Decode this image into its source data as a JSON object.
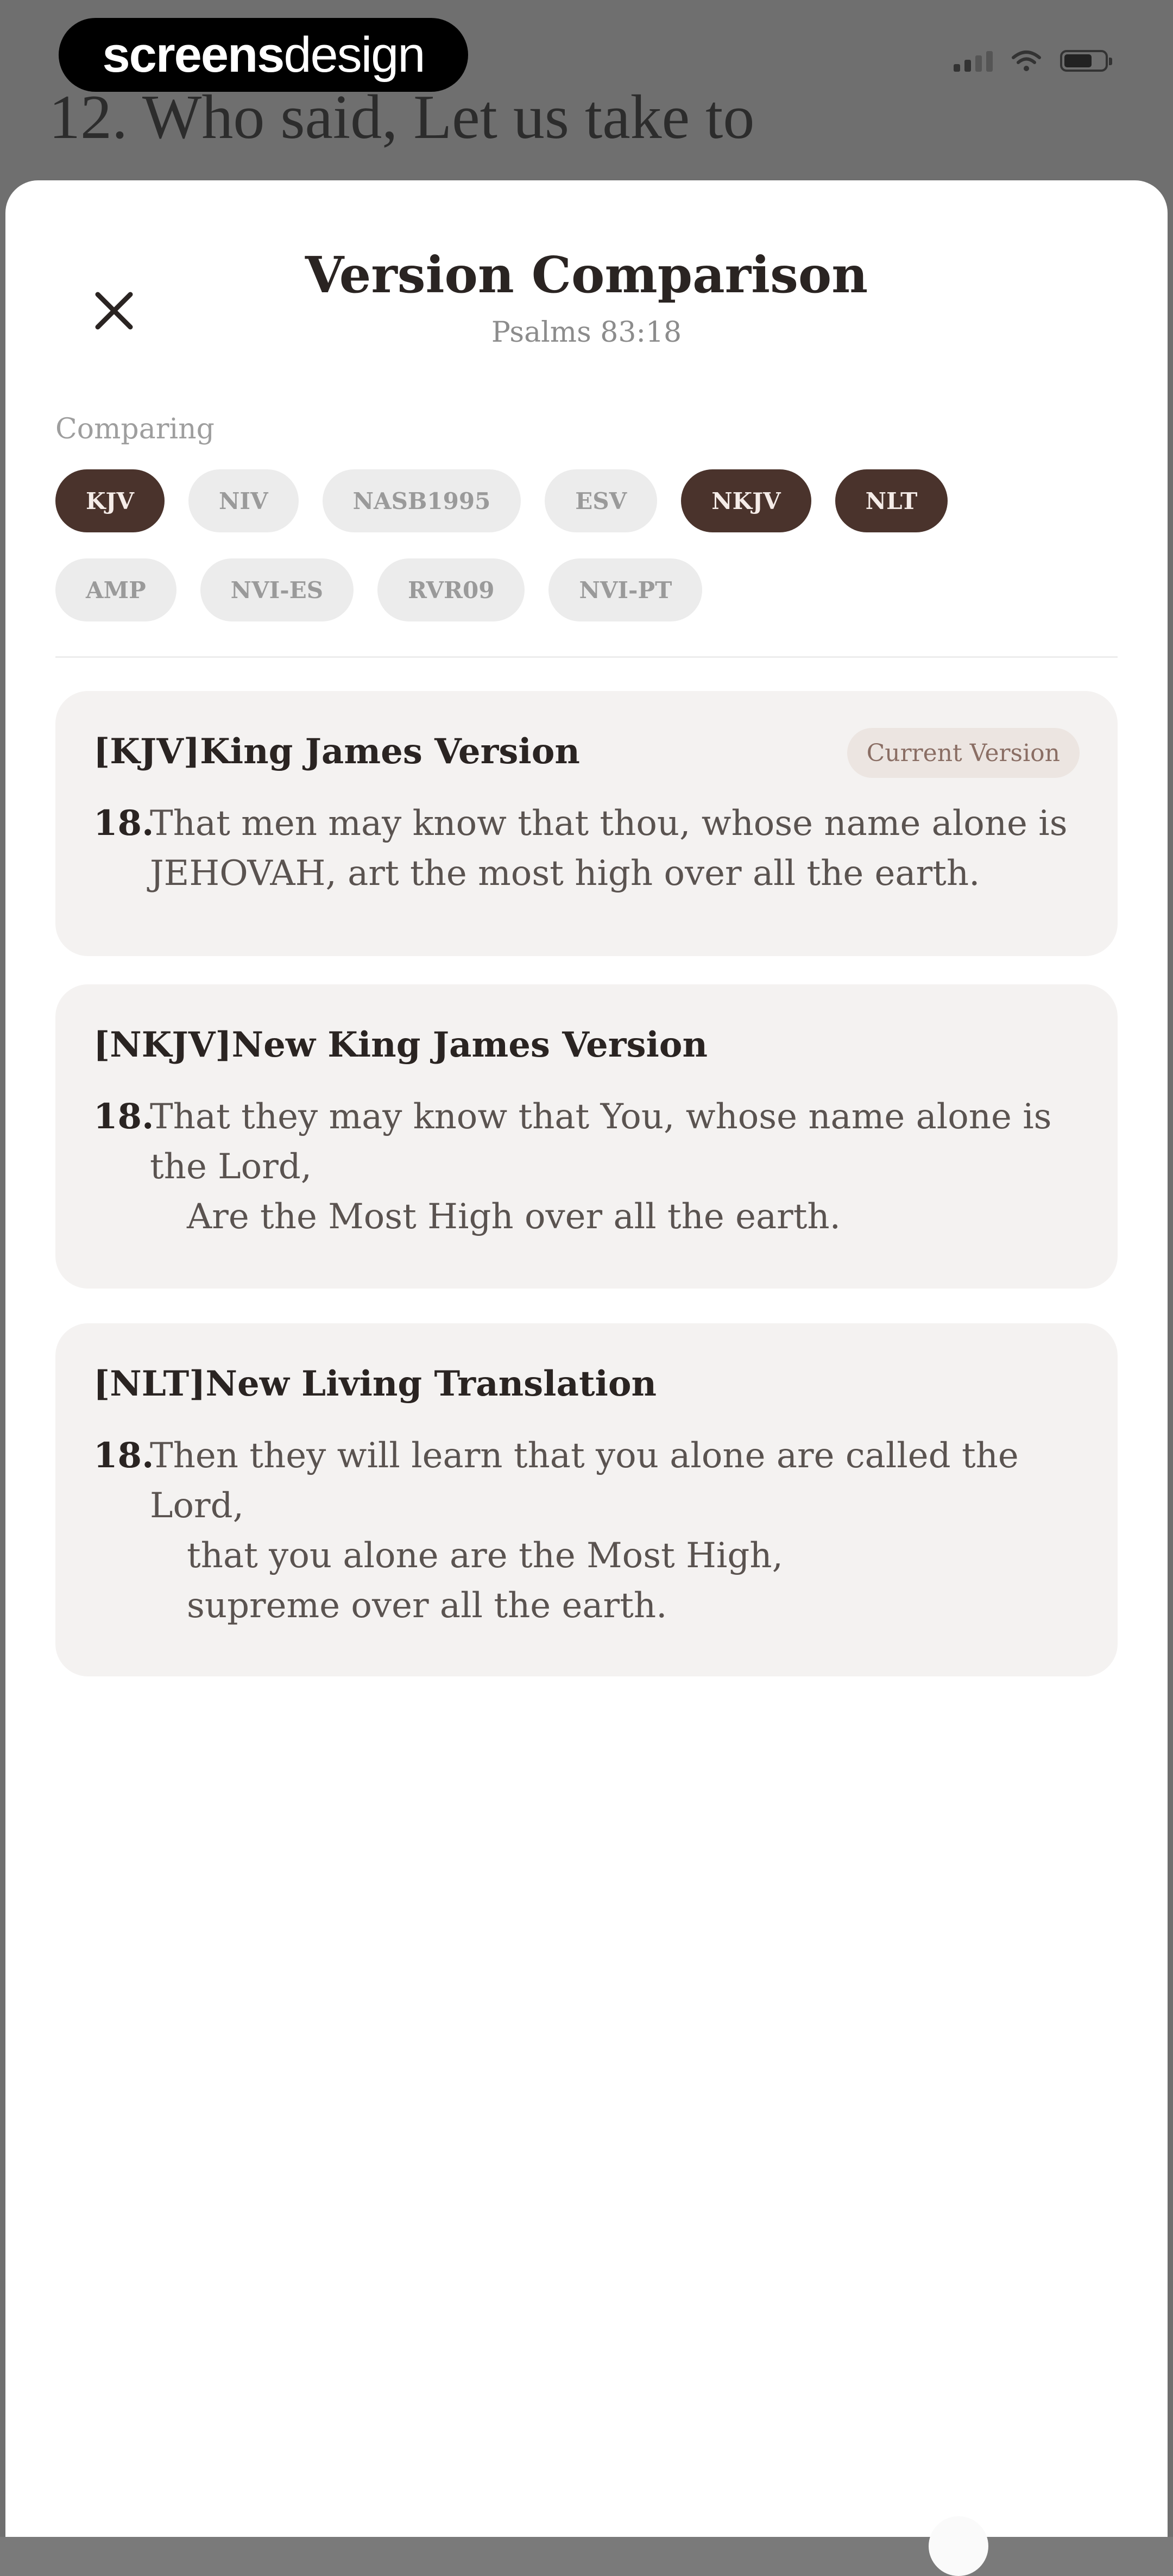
{
  "watermark": {
    "part1": "screens",
    "part2": "design"
  },
  "background": {
    "heading": "12. Who said, Let us take to"
  },
  "header": {
    "title": "Version Comparison",
    "subtitle": "Psalms 83:18"
  },
  "comparing": {
    "label": "Comparing",
    "chips": [
      {
        "label": "KJV",
        "selected": true
      },
      {
        "label": "NIV",
        "selected": false
      },
      {
        "label": "NASB1995",
        "selected": false
      },
      {
        "label": "ESV",
        "selected": false
      },
      {
        "label": "NKJV",
        "selected": true
      },
      {
        "label": "NLT",
        "selected": true
      },
      {
        "label": "AMP",
        "selected": false
      },
      {
        "label": "NVI-ES",
        "selected": false
      },
      {
        "label": "RVR09",
        "selected": false
      },
      {
        "label": "NVI-PT",
        "selected": false
      }
    ]
  },
  "cards": [
    {
      "title": "[KJV]King James Version",
      "badge": "Current Version",
      "verse_num": "18.",
      "lines": [
        "That men may know that thou, whose name alone is",
        "JEHOVAH, art the most high over all the earth."
      ]
    },
    {
      "title": "[NKJV]New King James Version",
      "verse_num": "18.",
      "lines": [
        "That they may know that You, whose name alone is",
        "the Lord,",
        "Are the Most High over all the earth."
      ]
    },
    {
      "title": "[NLT]New Living Translation",
      "verse_num": "18.",
      "lines": [
        "Then they will learn that you alone are called the",
        "Lord,",
        "that you alone are the Most High,",
        "supreme over all the earth."
      ]
    }
  ],
  "colors": {
    "selected_chip": "#4a332c",
    "unselected_chip": "#ececec",
    "card_bg": "#f4f2f1"
  }
}
